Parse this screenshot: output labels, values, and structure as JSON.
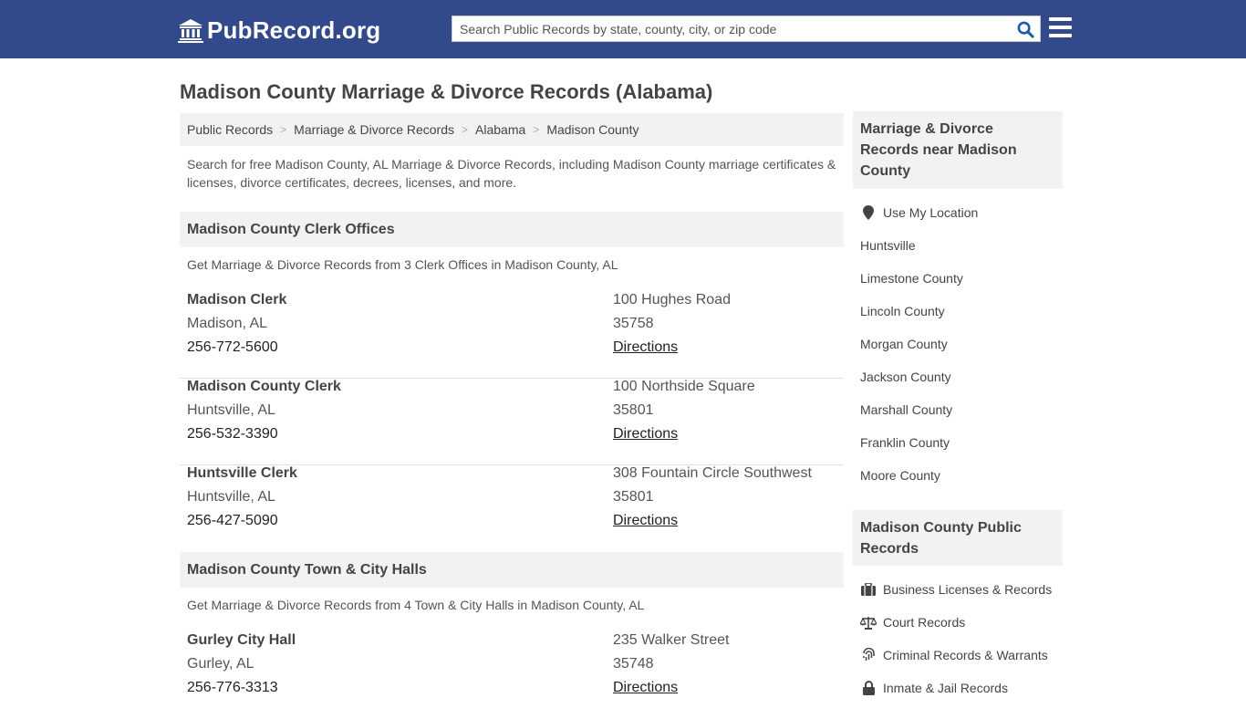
{
  "header": {
    "logo_text": "PubRecord.org",
    "search_placeholder": "Search Public Records by state, county, city, or zip code"
  },
  "main": {
    "title": "Madison County Marriage & Divorce Records (Alabama)",
    "breadcrumb": [
      "Public Records",
      "Marriage & Divorce Records",
      "Alabama",
      "Madison County"
    ],
    "intro": "Search for free Madison County, AL Marriage & Divorce Records, including Madison County marriage certificates & licenses, divorce certificates, decrees, licenses, and more.",
    "clerk_section": {
      "title": "Madison County Clerk Offices",
      "subtitle": "Get Marriage & Divorce Records from 3 Clerk Offices in Madison County, AL",
      "offices": [
        {
          "name": "Madison Clerk",
          "city": "Madison, AL",
          "phone": "256-772-5600",
          "address": "100 Hughes Road",
          "zip": "35758",
          "directions": "Directions"
        },
        {
          "name": "Madison County Clerk",
          "city": "Huntsville, AL",
          "phone": "256-532-3390",
          "address": "100 Northside Square",
          "zip": "35801",
          "directions": "Directions"
        },
        {
          "name": "Huntsville Clerk",
          "city": "Huntsville, AL",
          "phone": "256-427-5090",
          "address": "308 Fountain Circle Southwest",
          "zip": "35801",
          "directions": "Directions"
        }
      ]
    },
    "hall_section": {
      "title": "Madison County Town & City Halls",
      "subtitle": "Get Marriage & Divorce Records from 4 Town & City Halls in Madison County, AL",
      "offices": [
        {
          "name": "Gurley City Hall",
          "city": "Gurley, AL",
          "phone": "256-776-3313",
          "address": "235 Walker Street",
          "zip": "35748",
          "directions": "Directions"
        }
      ]
    }
  },
  "sidebar": {
    "nearby_title": "Marriage & Divorce Records near Madison County",
    "use_location": "Use My Location",
    "nearby": [
      "Huntsville",
      "Limestone County",
      "Lincoln County",
      "Morgan County",
      "Jackson County",
      "Marshall County",
      "Franklin County",
      "Moore County"
    ],
    "public_title": "Madison County Public Records",
    "public_links": [
      {
        "label": "Business Licenses & Records",
        "icon": "briefcase-icon"
      },
      {
        "label": "Court Records",
        "icon": "scales-icon"
      },
      {
        "label": "Criminal Records & Warrants",
        "icon": "fingerprint-icon"
      },
      {
        "label": "Inmate & Jail Records",
        "icon": "lock-icon"
      }
    ]
  },
  "colors": {
    "header_bg": "#324a8c",
    "panel_bg": "#f2f2f2",
    "search_icon": "#1a5ea8"
  }
}
